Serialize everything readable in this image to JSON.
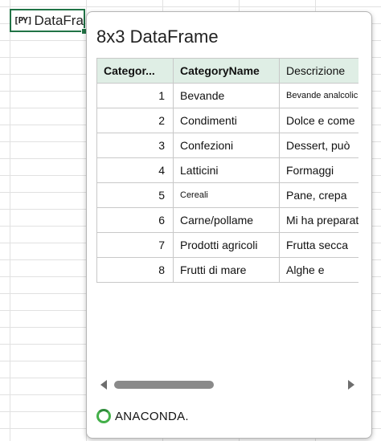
{
  "cell": {
    "icon_text": "[PY]",
    "text": "DataFrame"
  },
  "card": {
    "title": "8x3 DataFrame",
    "columns": [
      "CategoryID",
      "CategoryName",
      "Descrizione"
    ],
    "columns_display": [
      "Categor...",
      "CategoryName",
      "Descrizione"
    ],
    "rows": [
      {
        "id": "1",
        "name": "Bevande",
        "desc": "Bevande analcoliche, c"
      },
      {
        "id": "2",
        "name": "Condimenti",
        "desc": "Dolce e come"
      },
      {
        "id": "3",
        "name": "Confezioni",
        "desc": "Dessert, può"
      },
      {
        "id": "4",
        "name": "Latticini",
        "desc": "Formaggi"
      },
      {
        "id": "5",
        "name": "Cereali",
        "desc": "Pane, crepa"
      },
      {
        "id": "6",
        "name": "Carne/pollame",
        "desc": "Mi ha preparato;"
      },
      {
        "id": "7",
        "name": "Prodotti agricoli",
        "desc": "Frutta secca"
      },
      {
        "id": "8",
        "name": "Frutti di mare",
        "desc": "Alghe e"
      }
    ],
    "brand": "ANACONDA."
  },
  "colors": {
    "excel_green": "#217346",
    "header_bg": "#dfeee5",
    "anaconda_green": "#43b049"
  },
  "scroll": {
    "horizontal_position_fraction": 0.0,
    "visible_fraction": 0.38
  }
}
